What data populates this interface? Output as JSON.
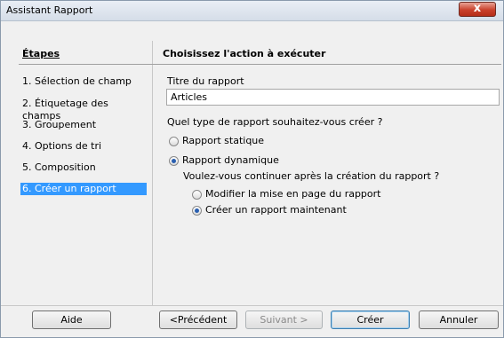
{
  "window": {
    "title": "Assistant Rapport",
    "close_glyph": "x"
  },
  "sidebar": {
    "title": "Étapes",
    "items": [
      {
        "label": "1. Sélection de champ"
      },
      {
        "label": "2. Étiquetage des champs"
      },
      {
        "label": "3. Groupement"
      },
      {
        "label": "4. Options de tri"
      },
      {
        "label": "5. Composition"
      },
      {
        "label": "6. Créer un rapport"
      }
    ]
  },
  "main": {
    "heading": "Choisissez l'action à exécuter",
    "title_label": "Titre du rapport",
    "title_value": "Articles",
    "type_question": "Quel type de rapport souhaitez-vous créer ?",
    "radio_static": "Rapport statique",
    "radio_dynamic": "Rapport dynamique",
    "continue_question": "Voulez-vous continuer après la création du rapport ?",
    "radio_modify": "Modifier la mise en page du rapport",
    "radio_create_now": "Créer un rapport maintenant",
    "selected_type": "Rapport dynamique",
    "selected_after": "Créer un rapport maintenant"
  },
  "buttons": {
    "help": "Aide",
    "previous": "<Précédent",
    "next": "Suivant >",
    "create": "Créer",
    "cancel": "Annuler"
  }
}
